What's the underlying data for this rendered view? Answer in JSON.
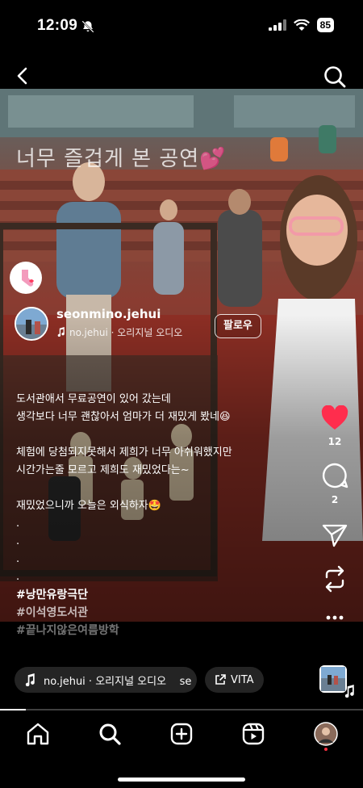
{
  "status_bar": {
    "time": "12:09",
    "battery": "85"
  },
  "post": {
    "overlay_text": "너무 즐겁게 본 공연💕",
    "username": "seonmino.jehui",
    "audio_label": "no.jehui · 오리지널 오디오",
    "follow_label": "팔로우",
    "caption_lines": [
      "도서관애서 무료공연이 있어 갔는데",
      "생각보다 너무 괜찮아서 엄마가 더 재밌게 봤네😆",
      "",
      "체험에 당첨되지못해서 제희가 너무 아쉬워했지만",
      "시간가는줄 모르고 제희도 재밌었다는~",
      "",
      "재밌었으니까 오늘은 외식하자🤩",
      ".",
      ".",
      ".",
      "."
    ],
    "hashtags": [
      "#낭만유랑극단",
      "#이석영도서관",
      "#끝나지않은여름방학"
    ]
  },
  "actions": {
    "likes": "12",
    "comments": "2"
  },
  "bottom": {
    "audio_chip": "no.jehui · 오리지널 오디오    se",
    "vita_chip": "VITA"
  },
  "video_progress": 0.07,
  "colors": {
    "like": "#ff2d4d",
    "nav_dot": "#ff3040",
    "background": "#000000"
  },
  "icons": [
    "back-icon",
    "search-icon",
    "heart-icon",
    "comment-icon",
    "share-icon",
    "remix-icon",
    "more-icon",
    "music-note-icon",
    "link-icon",
    "home-icon",
    "explore-icon",
    "create-icon",
    "reels-icon",
    "profile-icon"
  ]
}
